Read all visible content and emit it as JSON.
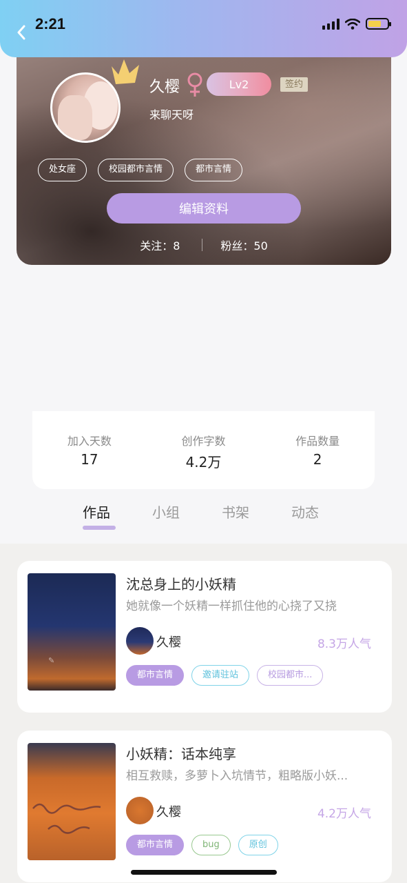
{
  "status_bar": {
    "time": "2:21"
  },
  "profile": {
    "name": "久樱",
    "gender_symbol": "♀",
    "level": "Lv2",
    "contract_badge": "签约",
    "bio": "来聊天呀",
    "tags": [
      "处女座",
      "校园都市言情",
      "都市言情"
    ],
    "edit_button": "编辑资料",
    "following": "关注：8",
    "followers": "粉丝：50"
  },
  "stats": [
    {
      "label": "加入天数",
      "value": "17"
    },
    {
      "label": "创作字数",
      "value": "4.2万"
    },
    {
      "label": "作品数量",
      "value": "2"
    }
  ],
  "tabs": [
    "作品",
    "小组",
    "书架",
    "动态"
  ],
  "books": [
    {
      "title": "沈总身上的小妖精",
      "description": "她就像一个妖精一样抓住他的心挠了又挠",
      "author": "久樱",
      "popularity": "8.3万人气",
      "tags": [
        "都市言情",
        "邀请驻站",
        "校园都市..."
      ]
    },
    {
      "title": "小妖精：话本纯享",
      "description": "相互救赎，多萝卜入坑情节，粗略版小妖...",
      "author": "久樱",
      "popularity": "4.2万人气",
      "tags": [
        "都市言情",
        "bug",
        "原创"
      ]
    }
  ],
  "colors": {
    "accent": "#b89be3",
    "header_gradient_start": "#7fd0f3",
    "header_gradient_end": "#c0a2e6",
    "popularity": "#c5a6e6"
  }
}
